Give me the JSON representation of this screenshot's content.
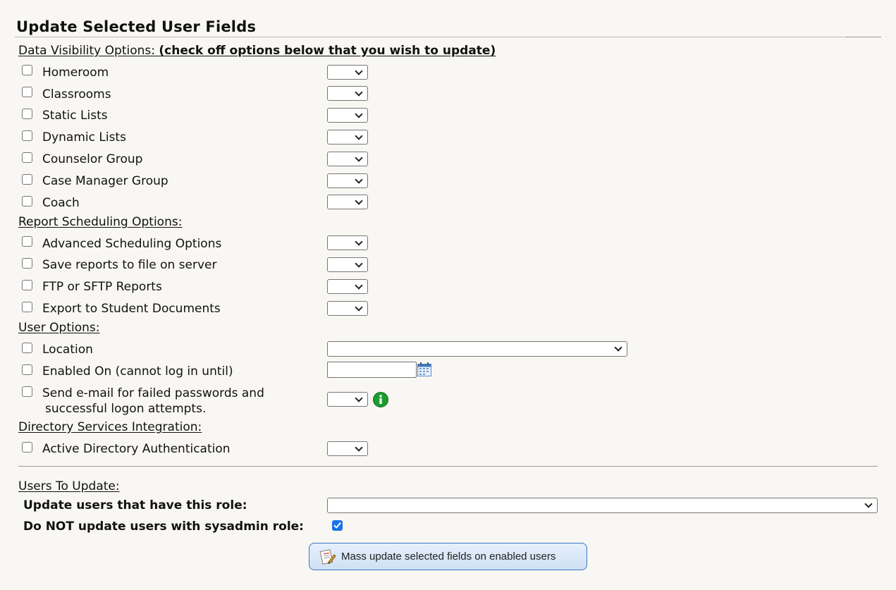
{
  "title": "Update Selected User Fields",
  "sections": {
    "data_visibility": "Data Visibility Options:",
    "data_visibility_note": "(check off options below that you wish to update)",
    "report_scheduling": "Report Scheduling Options:",
    "user_options": "User Options:",
    "directory_services": "Directory Services Integration:",
    "users_to_update": "Users To Update:"
  },
  "data_visibility_items": [
    "Homeroom",
    "Classrooms",
    "Static Lists",
    "Dynamic Lists",
    "Counselor Group",
    "Case Manager Group",
    "Coach"
  ],
  "report_scheduling_items": [
    "Advanced Scheduling Options",
    "Save reports to file on server",
    "FTP or SFTP Reports",
    "Export to Student Documents"
  ],
  "user_options_items": {
    "location": "Location",
    "enabled_on": "Enabled On (cannot log in until)",
    "send_email_line1": "Send e-mail for failed passwords and",
    "send_email_line2": "successful logon attempts."
  },
  "directory_items": [
    "Active Directory Authentication"
  ],
  "users_to_update": {
    "role_label": "Update users that have this role:",
    "role_value": "",
    "sysadmin_label": "Do NOT update users with sysadmin role:",
    "sysadmin_checked": true
  },
  "submit_button": "Mass update selected fields on enabled users",
  "icons": {
    "calendar": "calendar-icon",
    "info": "info-icon",
    "button": "edit-document-icon"
  },
  "colors": {
    "background": "#f8f7f3",
    "checkbox_checked": "#1a73e8",
    "info": "#1a9c2c",
    "button_border": "#3a78c8"
  }
}
